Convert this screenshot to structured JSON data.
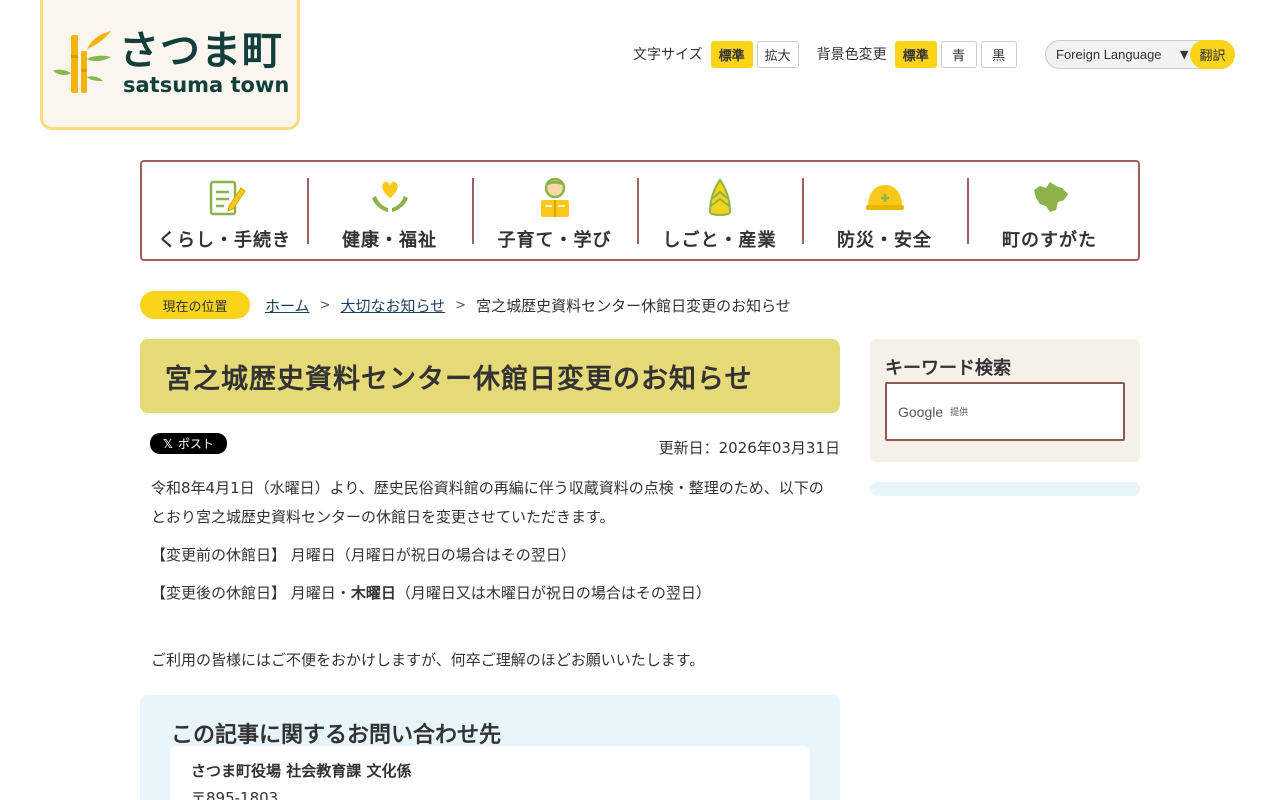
{
  "logo": {
    "ja": "さつま町",
    "en": "satsuma town"
  },
  "tools": {
    "font_size_label": "文字サイズ",
    "font_standard": "標準",
    "font_large": "拡大",
    "bg_label": "背景色変更",
    "bg_standard": "標準",
    "bg_blue": "青",
    "bg_black": "黒",
    "language_label": "Foreign Language",
    "language_caret": "▼",
    "translate": "翻訳"
  },
  "nav": {
    "items": [
      {
        "label": "くらし・手続き",
        "icon": "document-pen-icon"
      },
      {
        "label": "健康・福祉",
        "icon": "heart-hands-icon"
      },
      {
        "label": "子育て・学び",
        "icon": "child-reading-icon"
      },
      {
        "label": "しごと・産業",
        "icon": "bamboo-shoot-icon"
      },
      {
        "label": "防災・安全",
        "icon": "helmet-icon"
      },
      {
        "label": "町のすがた",
        "icon": "town-map-icon"
      }
    ]
  },
  "breadcrumb": {
    "badge": "現在の位置",
    "home": "ホーム",
    "parent": "大切なお知らせ",
    "current": "宮之城歴史資料センター休館日変更のお知らせ"
  },
  "article": {
    "title": "宮之城歴史資料センター休館日変更のお知らせ",
    "post_x": "𝕏",
    "post_label": "ポスト",
    "updated": "更新日：2026年03月31日",
    "para1": "令和8年4月1日（水曜日）より、歴史民俗資料館の再編に伴う収蔵資料の点検・整理のため、以下のとおり宮之城歴史資料センターの休館日を変更させていただきます。",
    "before_label": "【変更前の休館日】",
    "before_text": "月曜日（月曜日が祝日の場合はその翌日）",
    "after_label": "【変更後の休館日】",
    "after_text_1": "月曜日・",
    "after_text_bold": "木曜日",
    "after_text_2": "（月曜日又は木曜日が祝日の場合はその翌日）",
    "closing": "ご利用の皆様にはご不便をおかけしますが、何卒ご理解のほどお願いいたします。"
  },
  "contact": {
    "heading": "この記事に関するお問い合わせ先",
    "org": "さつま町役場 社会教育課 文化係",
    "zip": "〒895-1803"
  },
  "sidebar": {
    "search_heading": "キーワード検索",
    "google": "Google",
    "google_sub": "提供"
  },
  "colors": {
    "accent_yellow": "#f9d418",
    "nav_border": "#a0605f",
    "title_bg": "#e5d978",
    "logo_text": "#123f3c"
  }
}
